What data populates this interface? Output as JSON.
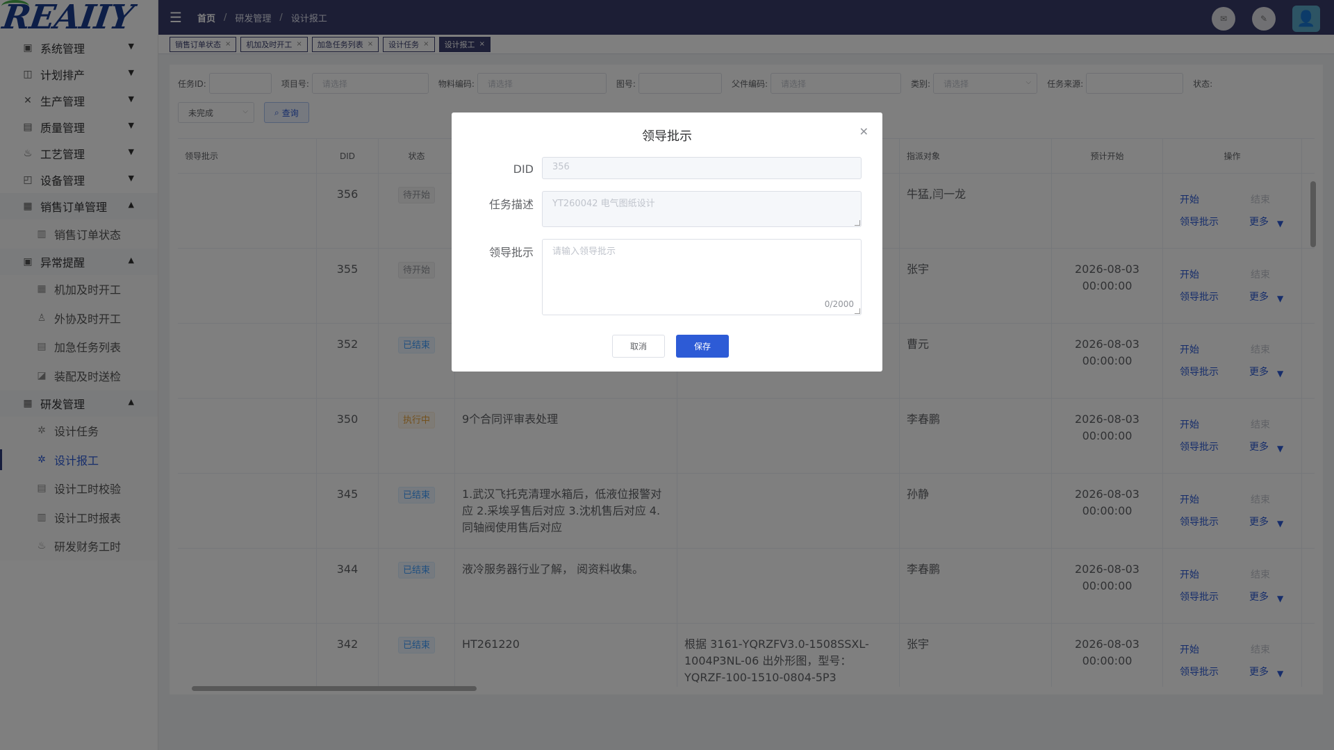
{
  "logo": {
    "text": "REAIIY"
  },
  "sidebar": {
    "items": [
      {
        "label": "系统管理",
        "icon": "monitor-icon",
        "expanded": false
      },
      {
        "label": "计划排产",
        "icon": "calendar-icon",
        "expanded": false
      },
      {
        "label": "生产管理",
        "icon": "tools-icon",
        "expanded": false
      },
      {
        "label": "质量管理",
        "icon": "document-icon",
        "expanded": false
      },
      {
        "label": "工艺管理",
        "icon": "flask-icon",
        "expanded": false
      },
      {
        "label": "设备管理",
        "icon": "device-icon",
        "expanded": false
      },
      {
        "label": "销售订单管理",
        "icon": "order-icon",
        "expanded": true
      },
      {
        "label": "异常提醒",
        "icon": "alert-monitor-icon",
        "expanded": true
      },
      {
        "label": "研发管理",
        "icon": "rnd-icon",
        "expanded": true
      }
    ],
    "sales_sub": [
      {
        "label": "销售订单状态"
      }
    ],
    "alert_sub": [
      {
        "label": "机加及时开工"
      },
      {
        "label": "外协及时开工"
      },
      {
        "label": "加急任务列表"
      },
      {
        "label": "装配及时送检"
      }
    ],
    "rnd_sub": [
      {
        "label": "设计任务"
      },
      {
        "label": "设计报工",
        "active": true
      },
      {
        "label": "设计工时校验"
      },
      {
        "label": "设计工时报表"
      },
      {
        "label": "研发财务工时"
      }
    ]
  },
  "header": {
    "breadcrumb": [
      "首页",
      "研发管理",
      "设计报工"
    ]
  },
  "tags": [
    {
      "label": "销售订单状态"
    },
    {
      "label": "机加及时开工"
    },
    {
      "label": "加急任务列表"
    },
    {
      "label": "设计任务"
    },
    {
      "label": "设计报工",
      "active": true
    }
  ],
  "filters": {
    "task_id_label": "任务ID:",
    "project_label": "项目号:",
    "project_placeholder": "请选择",
    "material_label": "物料编码:",
    "material_placeholder": "请选择",
    "drawing_label": "图号:",
    "parent_label": "父件编码:",
    "parent_placeholder": "请选择",
    "category_label": "类别:",
    "category_placeholder": "请选择",
    "source_label": "任务来源:",
    "status_label": "状态:",
    "status_value": "未完成",
    "query_button": "查询"
  },
  "table": {
    "headers": [
      "领导批示",
      "DID",
      "状态",
      "指派对象",
      "预计开始",
      "操作"
    ],
    "rows": [
      {
        "did": "356",
        "status": "待开始",
        "status_type": "wait",
        "desc": "",
        "extra": "",
        "assignee": "牛猛,闫一龙",
        "start": [
          "",
          ""
        ]
      },
      {
        "did": "355",
        "status": "待开始",
        "status_type": "wait",
        "desc": "",
        "extra": "",
        "assignee": "张宇",
        "start": [
          "2026-08-03",
          "00:00:00"
        ]
      },
      {
        "did": "352",
        "status": "已结束",
        "status_type": "done",
        "desc": "",
        "extra": "",
        "assignee": "曹元",
        "start": [
          "2026-08-03",
          "00:00:00"
        ]
      },
      {
        "did": "350",
        "status": "执行中",
        "status_type": "run",
        "desc": "9个合同评审表处理",
        "extra": "",
        "assignee": "李春鹏",
        "start": [
          "2026-08-03",
          "00:00:00"
        ]
      },
      {
        "did": "345",
        "status": "已结束",
        "status_type": "done",
        "desc": "1.武汉飞托克清理水箱后，低液位报警对应 2.采埃孚售后对应 3.沈机售后对应 4.同轴阀使用售后对应",
        "extra": "",
        "assignee": "孙静",
        "start": [
          "2026-08-03",
          "00:00:00"
        ]
      },
      {
        "did": "344",
        "status": "已结束",
        "status_type": "done",
        "desc": "液冷服务器行业了解， 阅资料收集。",
        "extra": "",
        "assignee": "李春鹏",
        "start": [
          "2026-08-03",
          "00:00:00"
        ]
      },
      {
        "did": "342",
        "status": "已结束",
        "status_type": "done",
        "desc": "HT261220",
        "extra": "根据 3161-YQRZFV3.0-1508SSXL-1004P3NL-06 出外形图，型号：YQRZF-100-1510-0804-5P3",
        "assignee": "张宇",
        "start": [
          "2026-08-03",
          "00:00:00"
        ]
      }
    ],
    "ops": {
      "start": "开始",
      "end": "结束",
      "approve": "领导批示",
      "more": "更多"
    }
  },
  "dialog": {
    "title": "领导批示",
    "did_label": "DID",
    "did_value": "356",
    "desc_label": "任务描述",
    "desc_value": "YT260042 电气图纸设计",
    "approve_label": "领导批示",
    "approve_placeholder": "请输入领导批示",
    "counter": "0/2000",
    "cancel": "取消",
    "save": "保存"
  },
  "colors": {
    "header": "#383d6b",
    "accent": "#2d5bd6",
    "overlay": "rgba(0,0,0,0.5)"
  }
}
